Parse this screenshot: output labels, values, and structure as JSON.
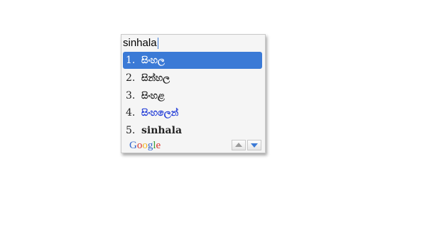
{
  "composition": {
    "text": "sinhala"
  },
  "candidates": [
    {
      "num": "1.",
      "word": "සිංහල",
      "selected": true
    },
    {
      "num": "2.",
      "word": "සින්හල",
      "selected": false
    },
    {
      "num": "3.",
      "word": "සිංහළ",
      "selected": false
    },
    {
      "num": "4.",
      "word": "සිංහලෙන්",
      "selected": false
    },
    {
      "num": "5.",
      "word": "sinhala",
      "selected": false
    }
  ],
  "footer": {
    "brand_letters": [
      "G",
      "o",
      "o",
      "g",
      "l",
      "e"
    ],
    "brand_colors": [
      "#3366cc",
      "#d9362b",
      "#f2b320",
      "#3366cc",
      "#3a9c3a",
      "#d9362b"
    ],
    "prev_icon": "triangle-up-icon",
    "next_icon": "triangle-down-icon"
  },
  "colors": {
    "selection": "#3b7ad6",
    "highlight_text": "#1a35d6"
  }
}
